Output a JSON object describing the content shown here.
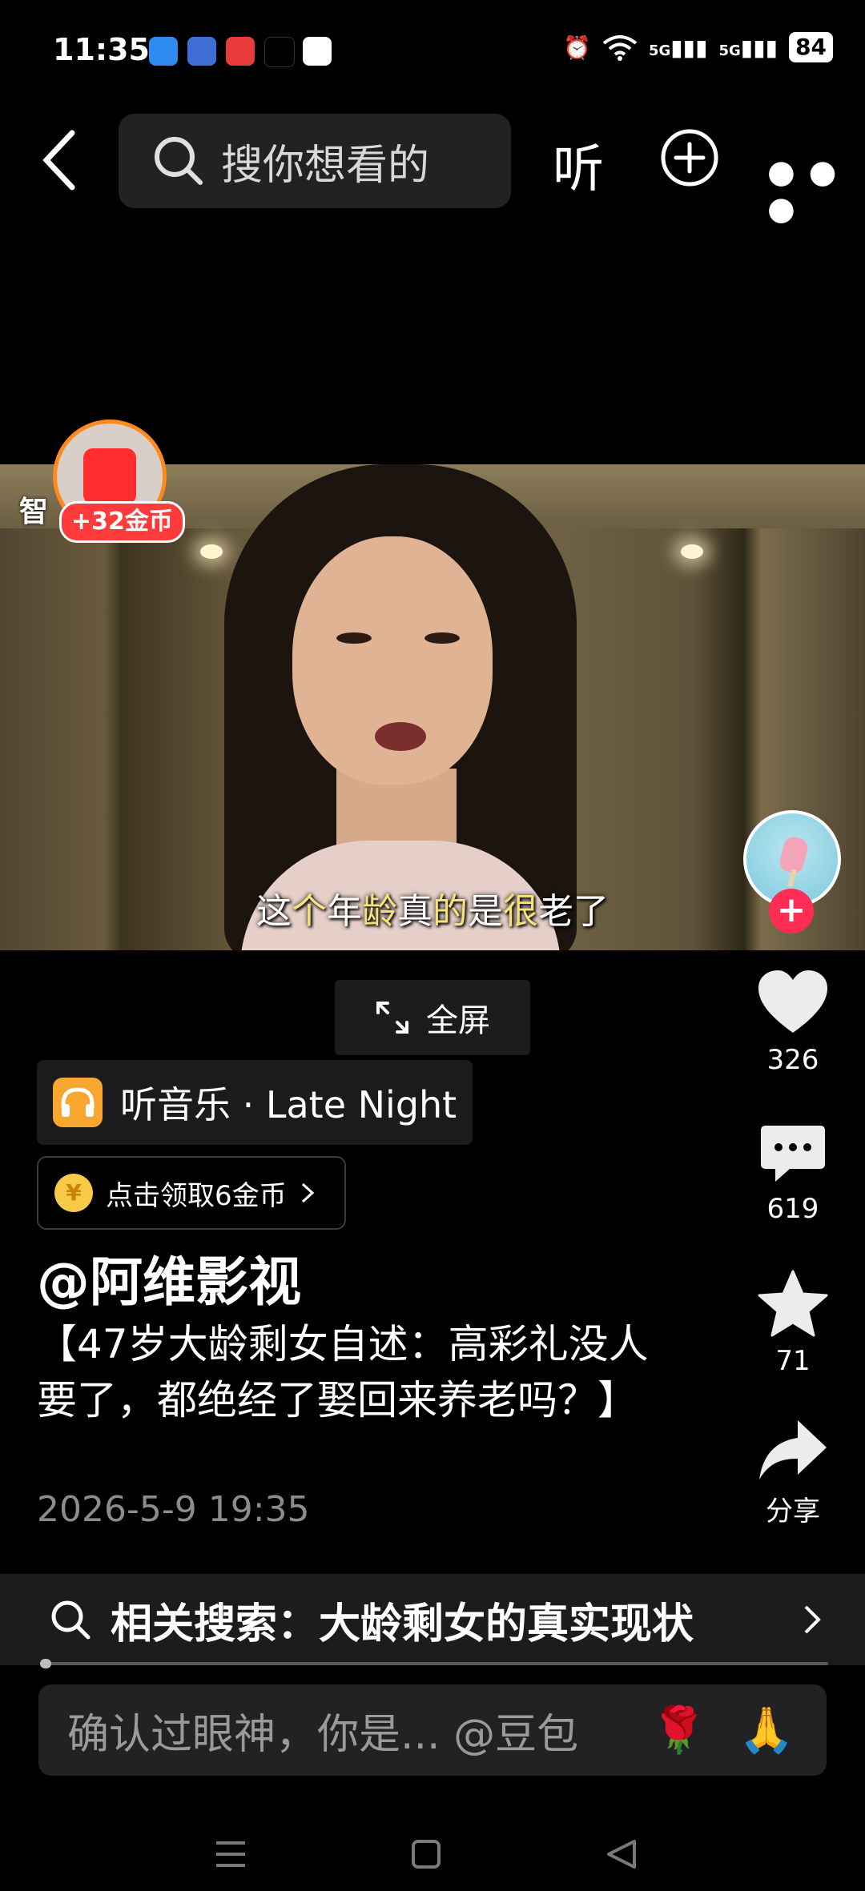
{
  "status_bar": {
    "time": "11:35",
    "battery": "84",
    "signal_labels": [
      "5G",
      "5G"
    ]
  },
  "top_bar": {
    "search_placeholder": "搜你想看的",
    "listen_label": "听"
  },
  "video": {
    "subtitle_parts": [
      "这",
      "个",
      "年",
      "龄",
      "真",
      "的",
      "是",
      "很",
      "老了"
    ]
  },
  "coin_badge": {
    "left_label": "智",
    "reward": "+32金币"
  },
  "rail": {
    "likes": "326",
    "comments": "619",
    "favorites": "71",
    "share_label": "分享"
  },
  "fullscreen_label": "全屏",
  "music_chip": {
    "label": "听音乐 · Late Night"
  },
  "reward_chip": {
    "coin_symbol": "¥",
    "label": "点击领取6金币"
  },
  "post": {
    "author": "@阿维影视",
    "title": "【47岁大龄剩女自述：高彩礼没人要了，都绝经了娶回来养老吗？】",
    "date": "2026-5-9 19:35"
  },
  "related_search": {
    "label": "相关搜索：大龄剩女的真实现状"
  },
  "comment_input": {
    "placeholder": "确认过眼神，你是... @豆包",
    "emoji_rose": "🌹",
    "emoji_pray": "🙏"
  },
  "colors": {
    "like_accent": "#ff2c55",
    "coin_orange": "#ff8a1c",
    "music_orange": "#f7a62f"
  }
}
